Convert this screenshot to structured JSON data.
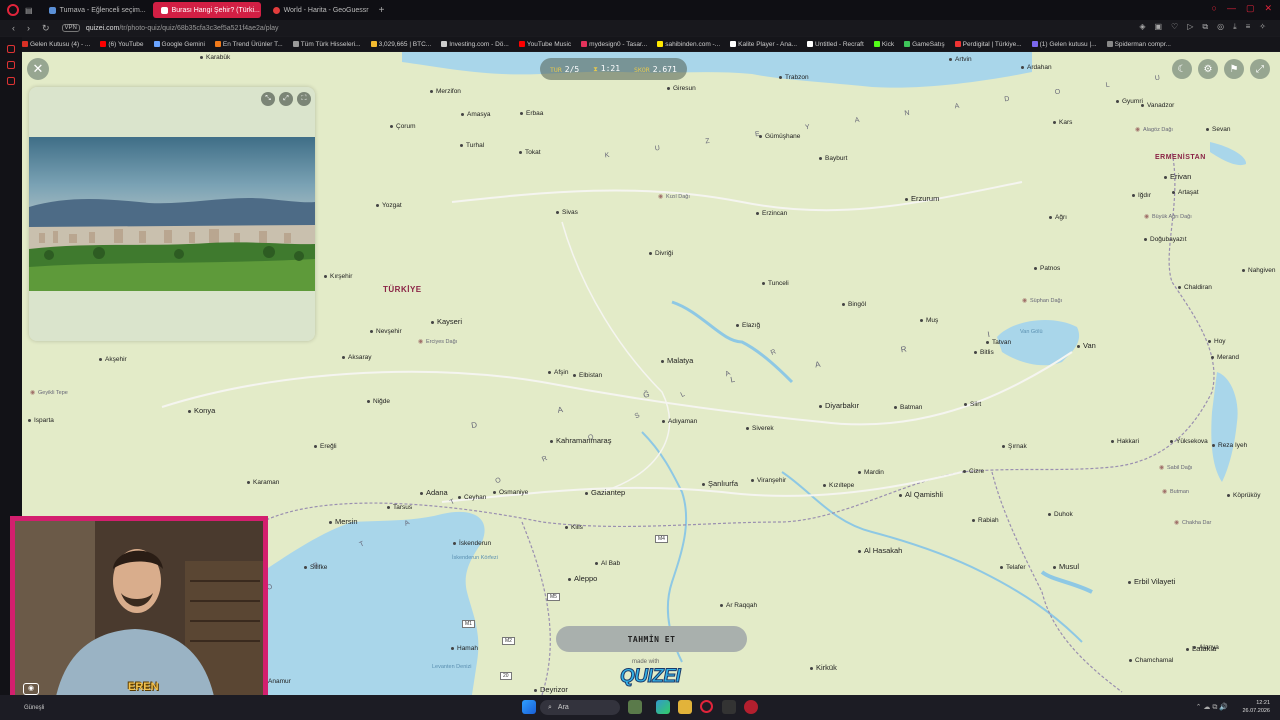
{
  "browser": {
    "tabs": [
      {
        "label": "Turnava - Eğlenceli seçim...",
        "active": false,
        "color": "#5a8fd6"
      },
      {
        "label": "Burası Hangi Şehir? (Türki...",
        "active": true,
        "color": "#ffffff"
      },
      {
        "label": "World - Harita - GeoGuessr",
        "active": false,
        "color": "#e23c3c"
      }
    ],
    "new_tab": "+",
    "vpn": "VPN",
    "url_host": "quizei.com",
    "url_path": "/tr/photo-quiz/quiz/68b35cfa3c3ef5a521f4ae2a/play",
    "bookmarks": [
      {
        "label": "Gelen Kutusu (4) - ...",
        "color": "#d93025"
      },
      {
        "label": "(6) YouTube",
        "color": "#ff0000"
      },
      {
        "label": "Google Gemini",
        "color": "#6aa4ff"
      },
      {
        "label": "En Trend Ürünler T...",
        "color": "#f27a1a"
      },
      {
        "label": "Tüm Türk Hisseleri...",
        "color": "#999999"
      },
      {
        "label": "3,029,665 | BTC...",
        "color": "#f3ba2f"
      },
      {
        "label": "Investing.com - Dö...",
        "color": "#cccccc"
      },
      {
        "label": "YouTube Music",
        "color": "#ff0000"
      },
      {
        "label": "mydesign0 - Tasar...",
        "color": "#e2325b"
      },
      {
        "label": "sahibinden.com -...",
        "color": "#ffe800"
      },
      {
        "label": "Kalite Player - Ana...",
        "color": "#ffffff"
      },
      {
        "label": "Untitled - Recraft",
        "color": "#ffffff"
      },
      {
        "label": "Kick",
        "color": "#53fc18"
      },
      {
        "label": "GameSatış",
        "color": "#3ec55a"
      },
      {
        "label": "Perdigital | Türkiye...",
        "color": "#e33"
      },
      {
        "label": "(1) Gelen kutusu |...",
        "color": "#7b68ee"
      },
      {
        "label": "Spiderman compr...",
        "color": "#888888"
      }
    ]
  },
  "hud": {
    "round_key": "TUR",
    "round_value": "2/5",
    "time_value": "1:21",
    "score_key": "SKOR",
    "score_value": "2.671"
  },
  "guess_button": "TAHMİN ET",
  "made_with": "made with",
  "brand": "QUIZEI",
  "webcam_name": "EREN",
  "map_labels": {
    "country_turkiye": "TÜRKİYE",
    "country_armenia": "ERMENİSTAN",
    "kuzey_anadolu": "K U Z E Y   A N A D O L U",
    "toros": "O R T A   T O R O S L A R",
    "dag_dlari": "D A Ğ L A R I",
    "cities": [
      {
        "name": "Karabük"
      },
      {
        "name": "Merzifon"
      },
      {
        "name": "Amasya"
      },
      {
        "name": "Çorum"
      },
      {
        "name": "Turhal"
      },
      {
        "name": "Erbaa"
      },
      {
        "name": "Tokat"
      },
      {
        "name": "Giresun"
      },
      {
        "name": "Trabzon"
      },
      {
        "name": "Artvin"
      },
      {
        "name": "Ardahan"
      },
      {
        "name": "Gümüşhane"
      },
      {
        "name": "Bayburt"
      },
      {
        "name": "Kars"
      },
      {
        "name": "Gyumri"
      },
      {
        "name": "Vanadzor"
      },
      {
        "name": "Sevan"
      },
      {
        "name": "Erivan"
      },
      {
        "name": "Artaşat"
      },
      {
        "name": "Iğdır"
      },
      {
        "name": "Doğubayazıt"
      },
      {
        "name": "Ağrı"
      },
      {
        "name": "Erzurum"
      },
      {
        "name": "Erzincan"
      },
      {
        "name": "Sivas"
      },
      {
        "name": "Yozgat"
      },
      {
        "name": "Divriği"
      },
      {
        "name": "Tunceli"
      },
      {
        "name": "Bingöl"
      },
      {
        "name": "Patnos"
      },
      {
        "name": "Muş"
      },
      {
        "name": "Elazığ"
      },
      {
        "name": "Tatvan"
      },
      {
        "name": "Bitlis"
      },
      {
        "name": "Van"
      },
      {
        "name": "Kırşehir"
      },
      {
        "name": "Kayseri"
      },
      {
        "name": "Nevşehir"
      },
      {
        "name": "Aksaray"
      },
      {
        "name": "Malatya"
      },
      {
        "name": "Afşin"
      },
      {
        "name": "Elbistan"
      },
      {
        "name": "Niğde"
      },
      {
        "name": "Konya"
      },
      {
        "name": "Akşehir"
      },
      {
        "name": "Isparta"
      },
      {
        "name": "Karaman"
      },
      {
        "name": "Ereğli"
      },
      {
        "name": "Kahramanmaraş"
      },
      {
        "name": "Adıyaman"
      },
      {
        "name": "Siverek"
      },
      {
        "name": "Diyarbakır"
      },
      {
        "name": "Batman"
      },
      {
        "name": "Siirt"
      },
      {
        "name": "Şırnak"
      },
      {
        "name": "Hakkari"
      },
      {
        "name": "Yüksekova"
      },
      {
        "name": "Hoy"
      },
      {
        "name": "Merand"
      },
      {
        "name": "Cizre"
      },
      {
        "name": "Mardin"
      },
      {
        "name": "Kızıltepe"
      },
      {
        "name": "Al Qamishli"
      },
      {
        "name": "Şanlıurfa"
      },
      {
        "name": "Viranşehir"
      },
      {
        "name": "Gaziantep"
      },
      {
        "name": "Osmaniye"
      },
      {
        "name": "Ceyhan"
      },
      {
        "name": "Adana"
      },
      {
        "name": "Tarsus"
      },
      {
        "name": "Mersin"
      },
      {
        "name": "İskenderun"
      },
      {
        "name": "Kilis"
      },
      {
        "name": "Silifke"
      },
      {
        "name": "Al Bab"
      },
      {
        "name": "Aleppo"
      },
      {
        "name": "Ar Raqqah"
      },
      {
        "name": "Al Hasakah"
      },
      {
        "name": "Duhok"
      },
      {
        "name": "Musul"
      },
      {
        "name": "Erbil Vilayeti"
      },
      {
        "name": "Latakia"
      },
      {
        "name": "Hamah"
      },
      {
        "name": "Deyrizor"
      },
      {
        "name": "Kirkük"
      },
      {
        "name": "Chamchamal"
      },
      {
        "name": "Alanya"
      },
      {
        "name": "Anamur"
      },
      {
        "name": "Gazimağusa"
      },
      {
        "name": "Rabiah"
      },
      {
        "name": "Telafer"
      },
      {
        "name": "Reza Iyeh"
      },
      {
        "name": "Nahgiven"
      },
      {
        "name": "Chaldiran"
      },
      {
        "name": "Köprüköy"
      }
    ],
    "mountains": [
      {
        "name": "Kızıl Dağı"
      },
      {
        "name": "Alagöz Dağı"
      },
      {
        "name": "Büyük Ağrı Dağı"
      },
      {
        "name": "Süphan Dağı"
      },
      {
        "name": "Erciyes Dağı"
      },
      {
        "name": "Geyikli Tepe"
      },
      {
        "name": "Sabil Dağı"
      },
      {
        "name": "Chakha Dar"
      },
      {
        "name": "Butman"
      }
    ],
    "water": [
      {
        "name": "Van Gölü"
      },
      {
        "name": "Levanten Denizi"
      },
      {
        "name": "İskenderun Körfezi"
      }
    ],
    "roads": [
      "M4",
      "M5",
      "M1",
      "20",
      "M2"
    ]
  },
  "taskbar": {
    "weather": "Güneşli",
    "search": "Ara",
    "time": "12:21",
    "date": "26.07.2026"
  }
}
